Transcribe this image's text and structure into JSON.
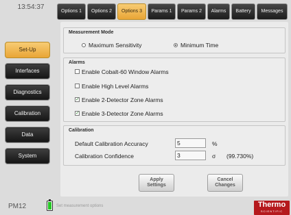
{
  "header": {
    "time": "13:54:37"
  },
  "sidebar": {
    "items": [
      {
        "label": "Set-Up",
        "active": true
      },
      {
        "label": "Interfaces",
        "active": false
      },
      {
        "label": "Diagnostics",
        "active": false
      },
      {
        "label": "Calibration",
        "active": false
      },
      {
        "label": "Data",
        "active": false
      },
      {
        "label": "System",
        "active": false
      }
    ]
  },
  "tabs": [
    {
      "label": "Options 1",
      "active": false
    },
    {
      "label": "Options 2",
      "active": false
    },
    {
      "label": "Options 3",
      "active": true
    },
    {
      "label": "Params 1",
      "active": false
    },
    {
      "label": "Params 2",
      "active": false
    },
    {
      "label": "Alarms",
      "active": false
    },
    {
      "label": "Battery",
      "active": false
    },
    {
      "label": "Messages",
      "active": false
    }
  ],
  "measurement_mode": {
    "title": "Measurement Mode",
    "options": [
      {
        "label": "Maximum Sensitivity",
        "selected": false
      },
      {
        "label": "Minimum Time",
        "selected": true
      }
    ]
  },
  "alarms": {
    "title": "Alarms",
    "items": [
      {
        "label": "Enable Cobalt-60 Window Alarms",
        "checked": false
      },
      {
        "label": "Enable High Level Alarms",
        "checked": false
      },
      {
        "label": "Enable 2-Detector Zone Alarms",
        "checked": true
      },
      {
        "label": "Enable 3-Detector Zone Alarms",
        "checked": true
      }
    ]
  },
  "calibration": {
    "title": "Calibration",
    "accuracy": {
      "label": "Default Calibration Accuracy",
      "value": "5",
      "unit": "%"
    },
    "confidence": {
      "label": "Calibration Confidence",
      "value": "3",
      "unit": "σ",
      "extra": "(99.730%)"
    }
  },
  "actions": {
    "apply": [
      "Apply",
      "Settings"
    ],
    "cancel": [
      "Cancel",
      "Changes"
    ]
  },
  "footer": {
    "device": "PM12",
    "battery_level": 0.85,
    "status": "Set measurement options",
    "logo": {
      "name": "Thermo",
      "tagline": "SCIENTIFIC"
    }
  },
  "colors": {
    "accent": "#eeb14e",
    "logo_red": "#b5191d",
    "battery_green": "#26c926"
  }
}
